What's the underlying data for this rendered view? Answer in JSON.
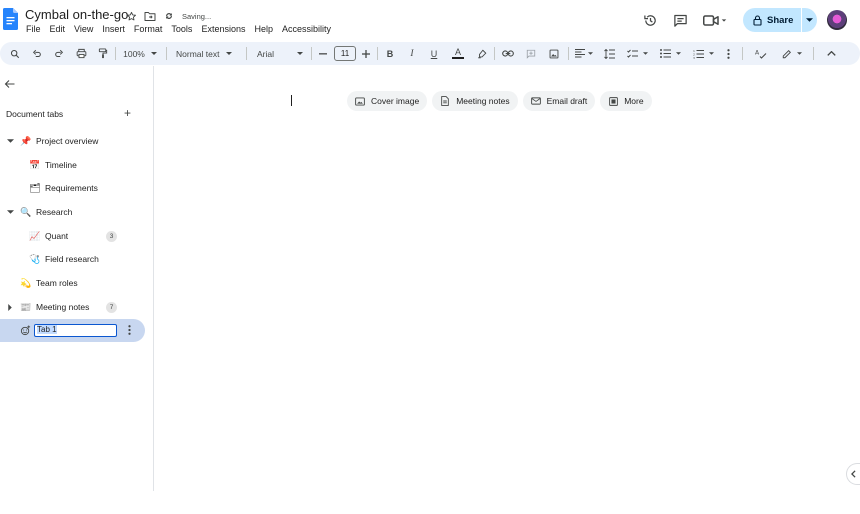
{
  "app": {
    "doc_title": "Cymbal on-the-go",
    "save_status": "Saving...",
    "share_label": "Share"
  },
  "menu": [
    "File",
    "Edit",
    "View",
    "Insert",
    "Format",
    "Tools",
    "Extensions",
    "Help",
    "Accessibility"
  ],
  "toolbar": {
    "zoom": "100%",
    "style": "Normal text",
    "font": "Arial",
    "font_size": "11"
  },
  "sidebar": {
    "header": "Document tabs",
    "tabs": [
      {
        "label": "Project overview",
        "emoji": "📌"
      },
      {
        "label": "Timeline",
        "emoji": "📅"
      },
      {
        "label": "Requirements",
        "emoji": "🗂"
      },
      {
        "label": "Research",
        "emoji": "🔍"
      },
      {
        "label": "Quant",
        "emoji": "📈",
        "badge": "3"
      },
      {
        "label": "Field research",
        "emoji": "🩺"
      },
      {
        "label": "Team roles",
        "emoji": "💫"
      },
      {
        "label": "Meeting notes",
        "emoji": "📰",
        "badge": "7"
      }
    ],
    "editing_tab": {
      "selected": "Tab",
      "rest": " 1"
    }
  },
  "chips": [
    {
      "label": "Cover image",
      "icon": "image-icon"
    },
    {
      "label": "Meeting notes",
      "icon": "document-icon"
    },
    {
      "label": "Email draft",
      "icon": "email-icon"
    },
    {
      "label": "More",
      "icon": "more-icon"
    }
  ],
  "colors": {
    "accent": "#0b57d0",
    "share_bg": "#c2e7ff",
    "toolbar_bg": "#edf2fa",
    "active_tab_bg": "#c8d7f0"
  }
}
